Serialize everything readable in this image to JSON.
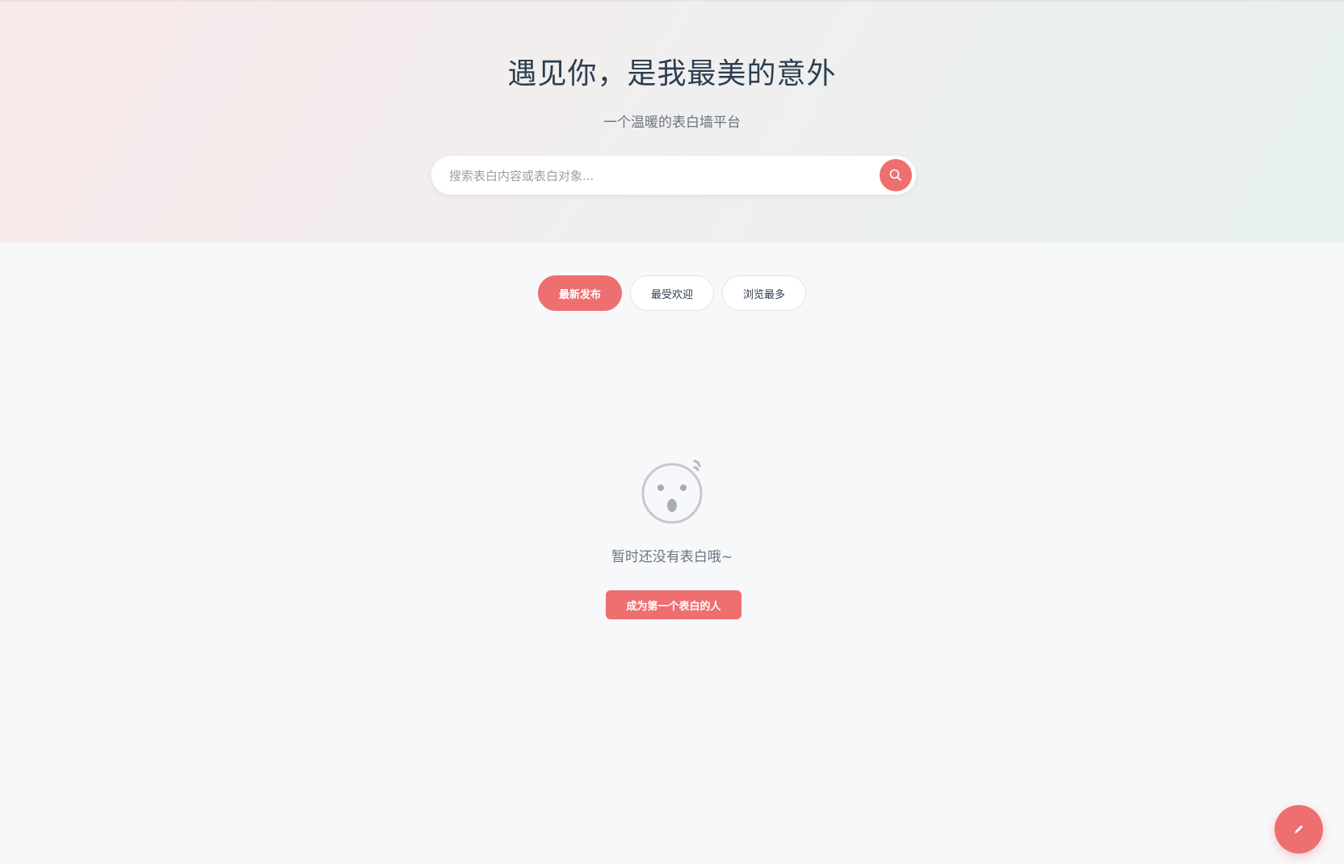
{
  "hero": {
    "title": "遇见你，是我最美的意外",
    "subtitle": "一个温暖的表白墙平台"
  },
  "search": {
    "placeholder": "搜索表白内容或表白对象...",
    "button_icon": "search-icon"
  },
  "tabs": [
    {
      "label": "最新发布",
      "active": true
    },
    {
      "label": "最受欢迎",
      "active": false
    },
    {
      "label": "浏览最多",
      "active": false
    }
  ],
  "empty_state": {
    "icon": "surprised-face-icon",
    "message": "暂时还没有表白哦~",
    "cta_label": "成为第一个表白的人"
  },
  "fab": {
    "icon": "pencil-icon"
  },
  "colors": {
    "accent": "#ee6f6f",
    "text_primary": "#2c3e50",
    "text_muted": "#6b7480",
    "background": "#f7f8fa"
  }
}
